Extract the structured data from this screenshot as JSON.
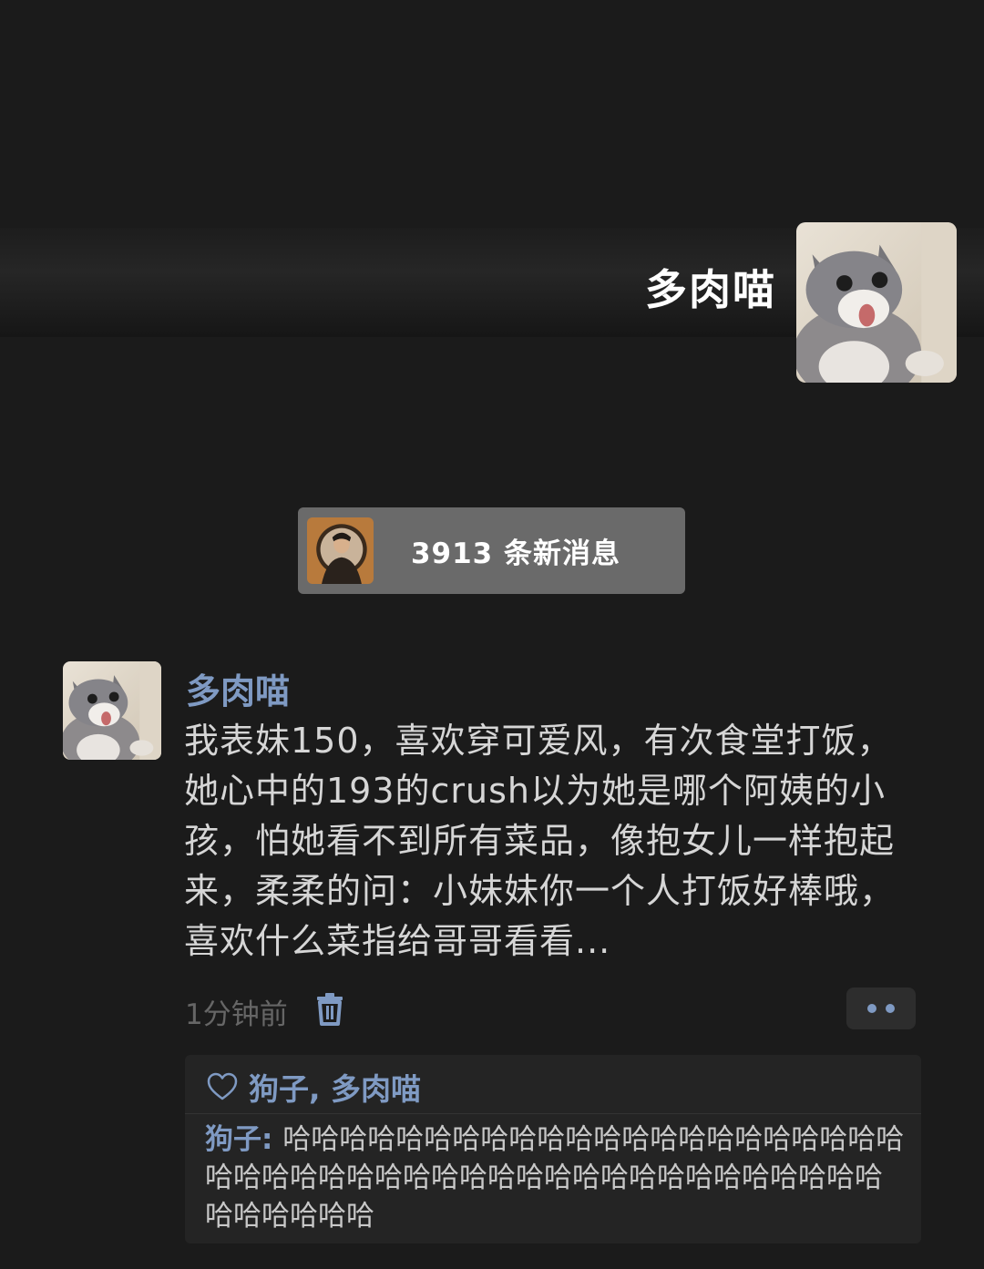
{
  "header": {
    "profile_name": "多肉喵"
  },
  "new_messages": {
    "label": "3913 条新消息"
  },
  "post": {
    "author": "多肉喵",
    "text": "我表妹150，喜欢穿可爱风，有次食堂打饭，她心中的193的crush以为她是哪个阿姨的小孩，怕她看不到所有菜品，像抱女儿一样抱起来，柔柔的问：小妹妹你一个人打饭好棒哦，喜欢什么菜指给哥哥看看...",
    "timestamp": "1分钟前",
    "icons": {
      "delete": "trash-icon",
      "more": "more-dots-icon"
    }
  },
  "interactions": {
    "likes": "狗子, 多肉喵",
    "like_icon": "heart-outline-icon",
    "comments": [
      {
        "author": "狗子: ",
        "text": "哈哈哈哈哈哈哈哈哈哈哈哈哈哈哈哈哈哈哈哈哈哈哈哈哈哈哈哈哈哈哈哈哈哈哈哈哈哈哈哈哈哈哈哈哈哈哈哈哈哈哈哈"
      }
    ]
  },
  "colors": {
    "background": "#1b1b1b",
    "link_blue": "#7f9ac3",
    "banner_gray": "#6a6a6a",
    "text": "#d6d6d6",
    "muted": "#666666"
  }
}
